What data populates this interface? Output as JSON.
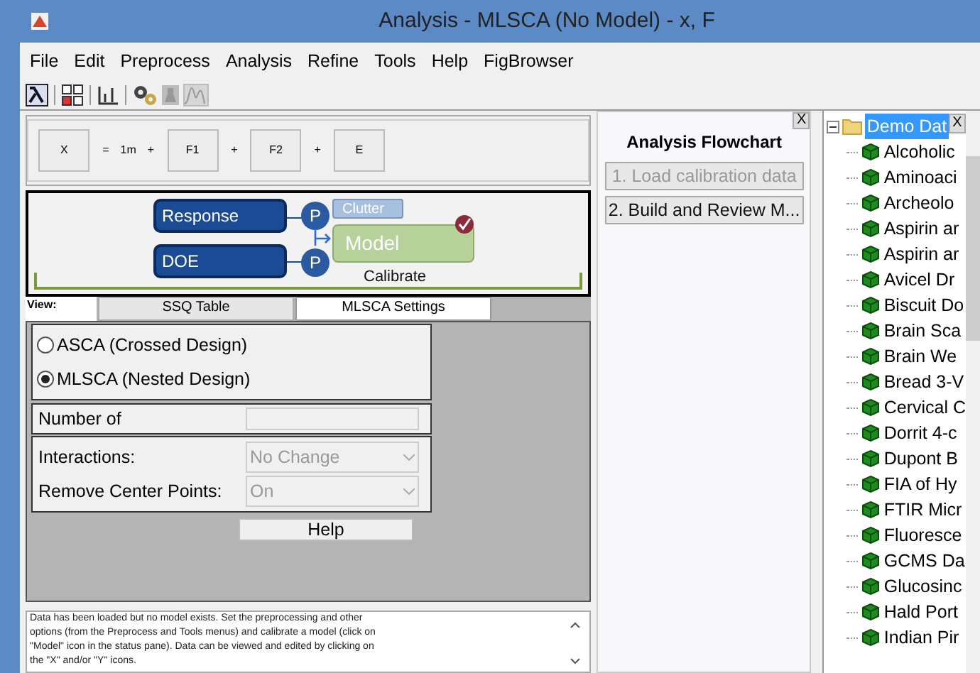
{
  "window": {
    "title": "Analysis - MLSCA (No Model) - x, F"
  },
  "menu": [
    "File",
    "Edit",
    "Preprocess",
    "Analysis",
    "Refine",
    "Tools",
    "Help",
    "FigBrowser"
  ],
  "equation": [
    {
      "kind": "box",
      "text": "X"
    },
    {
      "kind": "op",
      "text": "="
    },
    {
      "kind": "op",
      "text": "1m"
    },
    {
      "kind": "op",
      "text": "+"
    },
    {
      "kind": "box",
      "text": "F1"
    },
    {
      "kind": "op",
      "text": "+"
    },
    {
      "kind": "box",
      "text": "F2"
    },
    {
      "kind": "op",
      "text": "+"
    },
    {
      "kind": "box",
      "text": "E"
    }
  ],
  "status_pane": {
    "response": "Response",
    "doe": "DOE",
    "p1": "P",
    "p2": "P",
    "clutter": "Clutter",
    "model": "Model",
    "calibrate": "Calibrate"
  },
  "view": {
    "label": "View:",
    "tabs": [
      {
        "label": "SSQ Table",
        "selected": false
      },
      {
        "label": "MLSCA Settings",
        "selected": true
      }
    ]
  },
  "design": [
    {
      "label": "ASCA (Crossed Design)",
      "selected": false
    },
    {
      "label": "MLSCA (Nested Design)",
      "selected": true
    }
  ],
  "number_of": {
    "label": "Number of"
  },
  "interactions": {
    "label": "Interactions:",
    "value": "No Change"
  },
  "remove_center_points": {
    "label": "Remove Center Points:",
    "value": "On"
  },
  "help_button": "Help",
  "message": "Data has been loaded but no model exists. Set the preprocessing and other options (from the Preprocess and Tools menus) and calibrate a model (click on \"Model\" icon in the status pane). Data can be viewed and edited by clicking on the \"X\" and/or \"Y\" icons.",
  "flowchart": {
    "close": "X",
    "title": "Analysis Flowchart",
    "steps": [
      {
        "label": "1. Load calibration data",
        "disabled": true
      },
      {
        "label": "2. Build and Review M...",
        "disabled": false
      }
    ]
  },
  "tree": {
    "close": "X",
    "root": {
      "label": "Demo Dat",
      "selected": true,
      "expanded": true,
      "children": [
        {
          "label": "Alcoholic"
        },
        {
          "label": "Aminoaci"
        },
        {
          "label": "Archeolo"
        },
        {
          "label": "Aspirin ar"
        },
        {
          "label": "Aspirin ar"
        },
        {
          "label": "Avicel Dr"
        },
        {
          "label": "Biscuit Do"
        },
        {
          "label": "Brain Sca"
        },
        {
          "label": "Brain We"
        },
        {
          "label": "Bread 3-V"
        },
        {
          "label": "Cervical C"
        },
        {
          "label": "Dorrit 4-c"
        },
        {
          "label": "Dupont B"
        },
        {
          "label": "FIA of Hy"
        },
        {
          "label": "FTIR Micr"
        },
        {
          "label": "Fluoresce"
        },
        {
          "label": "GCMS Da"
        },
        {
          "label": "Glucosinc"
        },
        {
          "label": "Hald Port"
        },
        {
          "label": "Indian Pir"
        }
      ]
    }
  }
}
